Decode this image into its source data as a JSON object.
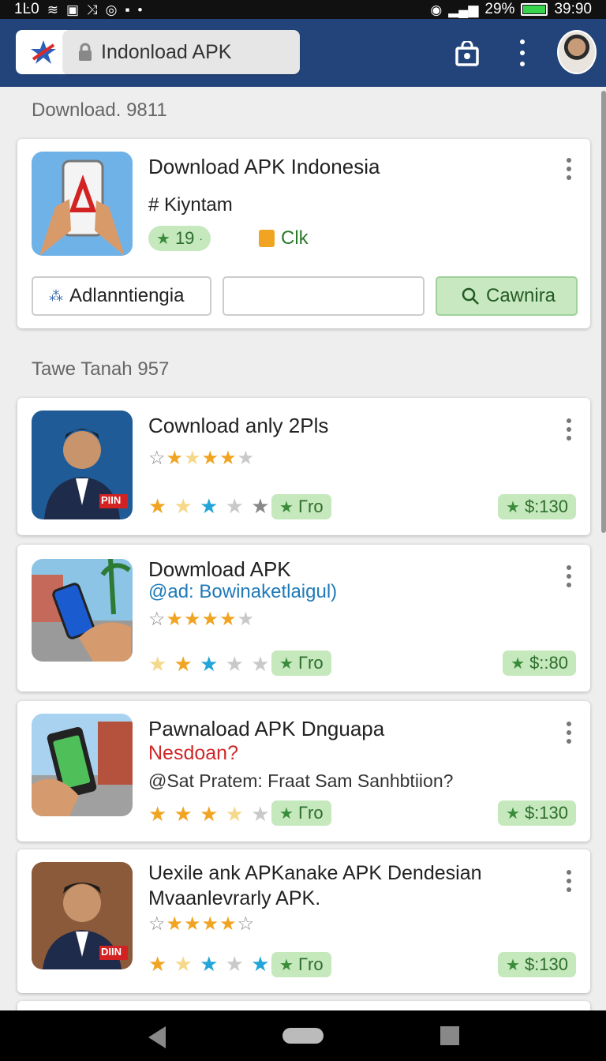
{
  "status": {
    "time_left": "1Ŀ0",
    "battery": "29%",
    "time_right": "39:90",
    "battery_level": 0.9
  },
  "appbar": {
    "url": "Indonload APK"
  },
  "section1": {
    "label": "Download. 9811"
  },
  "featured": {
    "title": "Download APK Indonesia",
    "tag": "# Kiyntam",
    "rating_pill": "19",
    "clk": "Clk",
    "button_left": "Adlanntiengia",
    "input_value": "",
    "button_search": "Cawnira"
  },
  "section2": {
    "label": "Tawe Tanah 957"
  },
  "apps": [
    {
      "title": "Cownload anly 2Pls",
      "subtitle": "",
      "desc": "",
      "badge": "PIIN",
      "stars_top": [
        "o",
        "g",
        "l",
        "g",
        "g",
        "e"
      ],
      "stars_bottom": [
        "g",
        "l",
        "b",
        "e",
        "e",
        "o"
      ],
      "pill": "Γro",
      "price": "$:130"
    },
    {
      "title": "Dowmload APK",
      "subtitle": "@ad: Bowinaketlaigul)",
      "desc": "",
      "badge": "",
      "stars_top": [
        "o",
        "g",
        "g",
        "g",
        "g",
        "e"
      ],
      "stars_bottom": [
        "l",
        "g",
        "b",
        "e",
        "e",
        "e"
      ],
      "pill": "Γro",
      "price": "$::80"
    },
    {
      "title": "Pawnaload APK Dnguapa",
      "subtitle": "Nesdoan?",
      "desc": "@Sat Pratem: Fraat Sam Sanhbtiion?",
      "badge": "",
      "stars_bottom": [
        "g",
        "g",
        "g",
        "l",
        "e",
        "e"
      ],
      "pill": "Γro",
      "price": "$:130"
    },
    {
      "title": "Uexile ank APKanake APK Dendesian",
      "subtitle2": "Mvaanlevrarly APK.",
      "desc": "",
      "badge": "DIIN",
      "stars_top": [
        "o",
        "g",
        "g",
        "g",
        "g",
        "o"
      ],
      "stars_bottom": [
        "g",
        "l",
        "b",
        "e",
        "e",
        "b"
      ],
      "pill": "Γro",
      "price": "$:130"
    }
  ],
  "colors": {
    "appbar": "#23447a",
    "accent_green": "#c5e8bd",
    "blue_link": "#1e7ab8",
    "red_text": "#d02828"
  }
}
